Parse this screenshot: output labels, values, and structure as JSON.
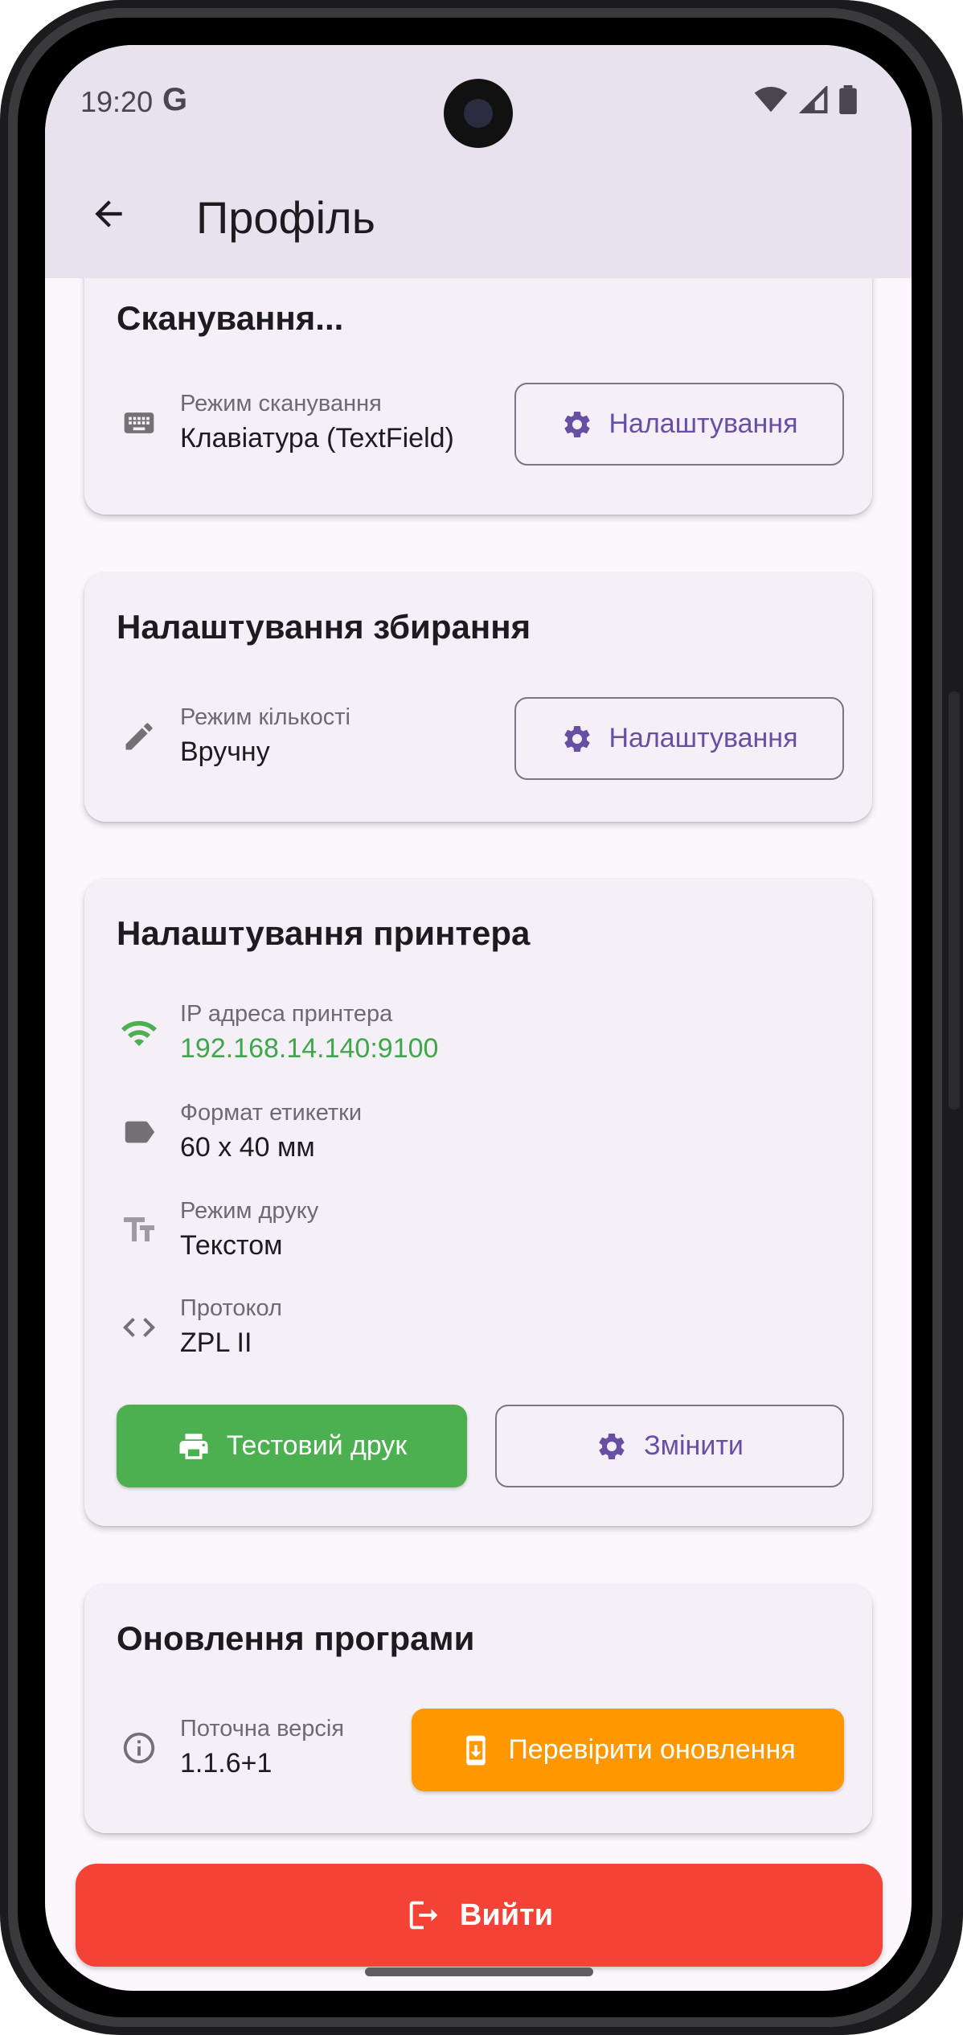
{
  "status_bar": {
    "time": "19:20",
    "g_label": "G",
    "icons": [
      "wifi-icon",
      "signal-icon",
      "battery-icon"
    ]
  },
  "app_bar": {
    "title": "Профіль",
    "back_icon": "arrow-back-icon"
  },
  "scanning_card": {
    "title_partial": "Сканування...",
    "mode_label": "Режим сканування",
    "mode_value": "Клавіатура (TextField)",
    "settings_button": "Налаштування"
  },
  "picking_card": {
    "title": "Налаштування збирання",
    "quantity_label": "Режим кількості",
    "quantity_value": "Вручну",
    "settings_button": "Налаштування"
  },
  "printer_card": {
    "title": "Налаштування принтера",
    "rows": [
      {
        "label": "IP адреса принтера",
        "value": "192.168.14.140:9100",
        "icon": "wifi-icon"
      },
      {
        "label": "Формат етикетки",
        "value": "60 x 40 мм",
        "icon": "label-icon"
      },
      {
        "label": "Режим друку",
        "value": "Текстом",
        "icon": "text-fields-icon"
      },
      {
        "label": "Протокол",
        "value": "ZPL II",
        "icon": "code-icon"
      }
    ],
    "test_print_button": "Тестовий друк",
    "change_button": "Змінити"
  },
  "update_card": {
    "title": "Оновлення програми",
    "version_label": "Поточна версія",
    "version_value": "1.1.6+1",
    "check_button": "Перевірити оновлення"
  },
  "logout_button": "Вийти",
  "colors": {
    "accent": "#6750a4",
    "green": "#4caf50",
    "orange": "#ff9800",
    "red": "#f44336",
    "ip_green": "#3fa74a"
  }
}
